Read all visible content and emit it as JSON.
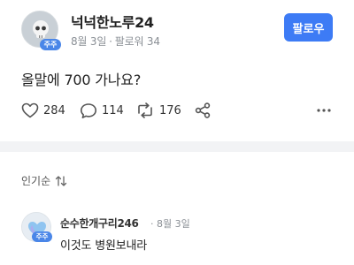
{
  "post": {
    "author": "넉넉한노루24",
    "badge": "주주",
    "date": "8월 3일",
    "separator": "·",
    "followers": "팔로워 34",
    "follow_label": "팔로우",
    "content": "올말에 700 가나요?",
    "likes": "284",
    "comments": "114",
    "reposts": "176",
    "icons": {
      "like": "heart-icon",
      "comment": "speech-bubble-icon",
      "repost": "repost-icon",
      "share": "share-icon",
      "more": "more-icon"
    }
  },
  "sort": {
    "label": "인기순",
    "icon": "sort-icon"
  },
  "comment": {
    "author": "순수한개구리246",
    "separator": "·",
    "date": "8월 3일",
    "badge": "주주",
    "text": "이것도 병원보내라"
  },
  "colors": {
    "accent": "#3d7bf5",
    "badge": "#4a86e8",
    "divider": "#f2f3f5",
    "muted": "#8a8f95"
  }
}
